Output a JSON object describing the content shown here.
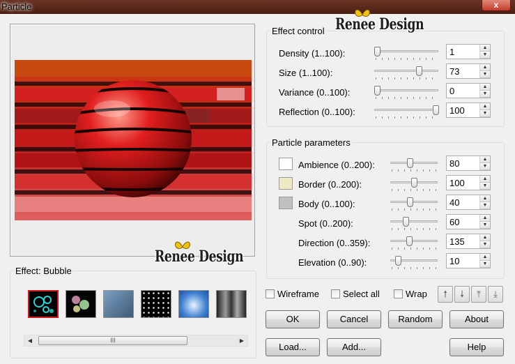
{
  "window": {
    "title": "Particle",
    "close_glyph": "x"
  },
  "watermark": {
    "text": "Renee Design"
  },
  "effect_control": {
    "title": "Effect control",
    "rows": [
      {
        "label": "Density (1..100):",
        "value": "1",
        "level_pct": 0
      },
      {
        "label": "Size (1..100):",
        "value": "73",
        "level_pct": 72
      },
      {
        "label": "Variance (0..100):",
        "value": "0",
        "level_pct": 0
      },
      {
        "label": "Reflection (0..100):",
        "value": "100",
        "level_pct": 100
      }
    ]
  },
  "particle_parameters": {
    "title": "Particle parameters",
    "rows": [
      {
        "label": "Ambience (0..200):",
        "value": "80",
        "level_pct": 40,
        "swatch": "#ffffff"
      },
      {
        "label": "Border (0..200):",
        "value": "100",
        "level_pct": 50,
        "swatch": "#eeeac4"
      },
      {
        "label": "Body (0..100):",
        "value": "40",
        "level_pct": 40,
        "swatch": "#c0c0c0"
      },
      {
        "label": "Spot (0..200):",
        "value": "60",
        "level_pct": 30
      },
      {
        "label": "Direction (0..359):",
        "value": "135",
        "level_pct": 38
      },
      {
        "label": "Elevation (0..90):",
        "value": "10",
        "level_pct": 11
      }
    ]
  },
  "effect_group": {
    "title": "Effect: Bubble",
    "selected_index": 0,
    "scroll_thumb_glyph": "III"
  },
  "checkboxes": {
    "wireframe": "Wireframe",
    "select_all": "Select all",
    "wrap": "Wrap"
  },
  "buttons": {
    "ok": "OK",
    "cancel": "Cancel",
    "random": "Random",
    "about": "About",
    "load": "Load...",
    "add": "Add...",
    "help": "Help"
  },
  "colors": {
    "title_bar": "#5a2a1c",
    "close_button": "#c43c2c",
    "selected_thumb_border": "#d01818"
  }
}
